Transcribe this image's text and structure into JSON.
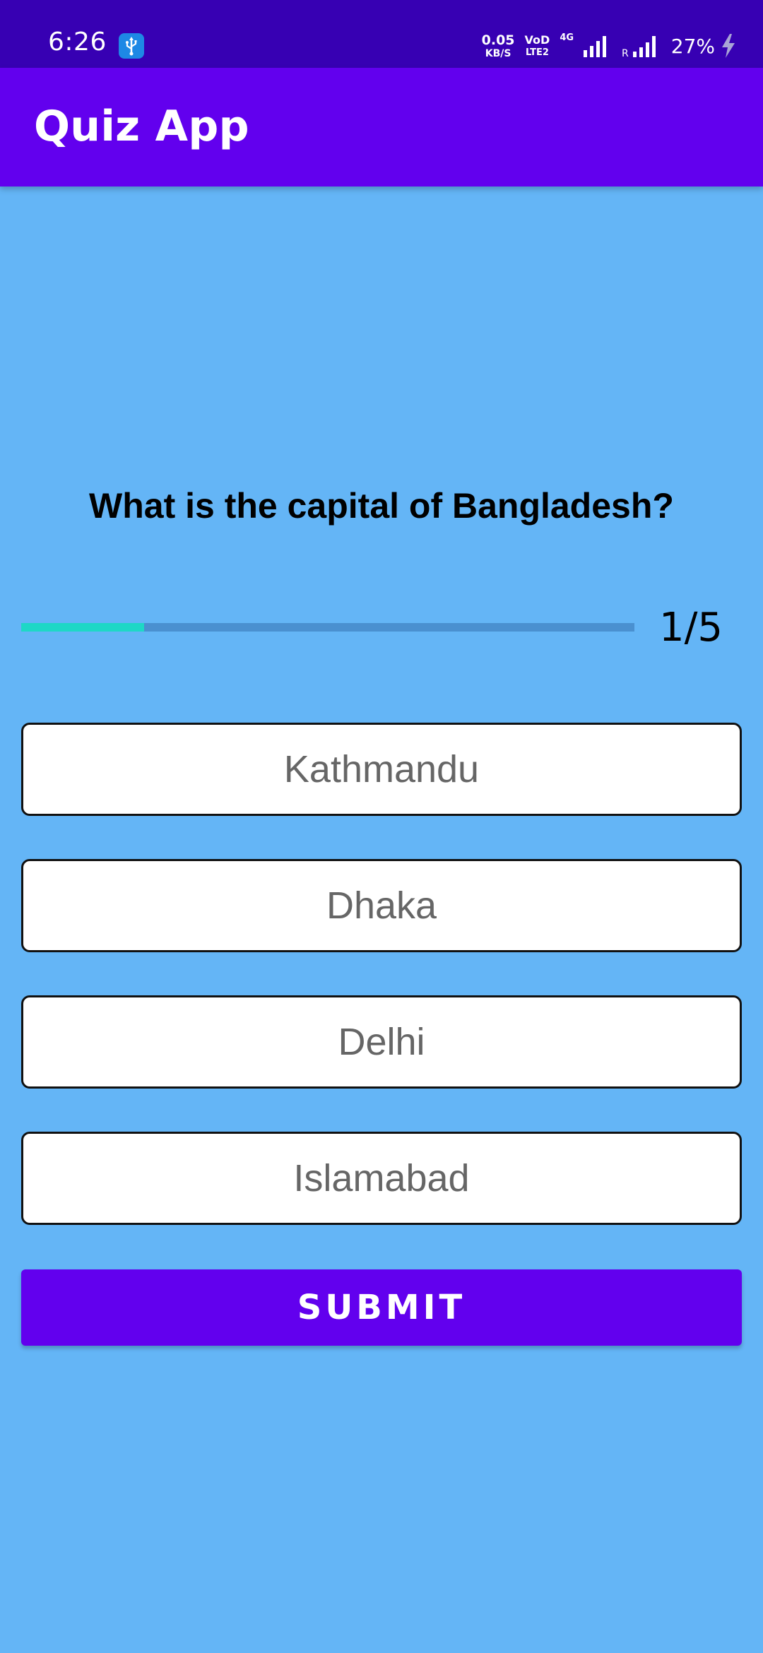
{
  "status_bar": {
    "time": "6:26",
    "usb_icon": "usb-icon",
    "net_speed_value": "0.05",
    "net_speed_unit": "KB/S",
    "volte_top": "VoD",
    "volte_bottom": "LTE2",
    "network_type": "4G",
    "roaming": "R",
    "battery": "27%",
    "charging_icon": "bolt-icon"
  },
  "app_bar": {
    "title": "Quiz App",
    "color": "#6200ee"
  },
  "quiz": {
    "question": "What is the capital of Bangladesh?",
    "progress_text": "1/5",
    "progress_fraction": 0.2,
    "progress_color": "#1ed8c6",
    "options": [
      "Kathmandu",
      "Dhaka",
      "Delhi",
      "Islamabad"
    ],
    "submit_label": "SUBMIT"
  },
  "colors": {
    "background": "#64b5f6",
    "status_bar": "#3700b3",
    "accent": "#6200ee"
  }
}
